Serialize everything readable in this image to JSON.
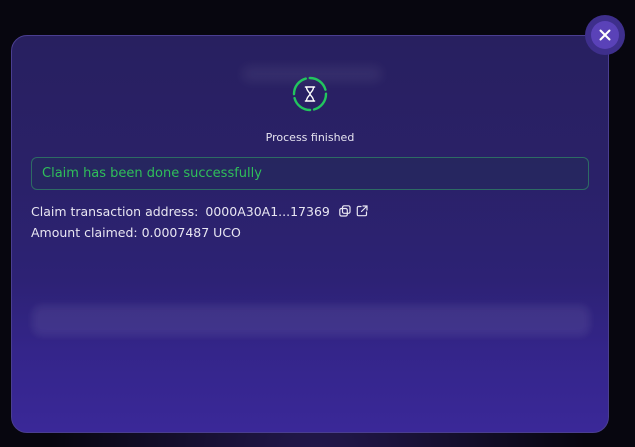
{
  "dialog": {
    "status_label": "Process finished",
    "success_message": "Claim has been done successfully",
    "claim_tx_label": "Claim transaction address:",
    "claim_tx_address": "0000A30A1...17369",
    "amount_claimed_label": "Amount claimed:",
    "amount_claimed_value": "0.0007487 UCO"
  },
  "icons": {
    "status": "hourglass-icon",
    "close": "close-icon",
    "copy": "copy-icon",
    "external": "external-link-icon"
  },
  "colors": {
    "success_text": "#2fbf5a",
    "success_border": "#2d6b64",
    "status_ring": "#22c55e",
    "dialog_bg": "#2a2168",
    "close_button": "#5a42b8"
  }
}
